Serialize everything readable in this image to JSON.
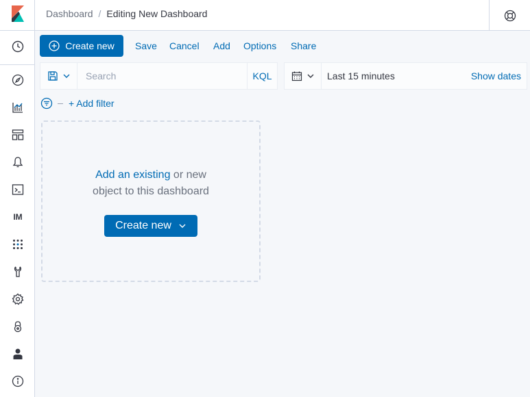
{
  "sidebar": {
    "items": [
      {
        "icon": "kibana-logo-icon"
      },
      {
        "icon": "recently-viewed-icon"
      },
      {
        "icon": "discover-icon"
      },
      {
        "icon": "visualize-icon"
      },
      {
        "icon": "dashboard-icon"
      },
      {
        "icon": "alerting-icon"
      },
      {
        "icon": "dev-tools-icon"
      },
      {
        "icon": "index-management-icon",
        "text": "IM"
      },
      {
        "icon": "apps-icon"
      },
      {
        "icon": "maintenance-icon"
      },
      {
        "icon": "settings-icon"
      },
      {
        "icon": "security-icon"
      },
      {
        "icon": "user-icon"
      },
      {
        "icon": "info-icon"
      }
    ]
  },
  "header": {
    "breadcrumb_root": "Dashboard",
    "breadcrumb_separator": "/",
    "breadcrumb_current": "Editing New Dashboard"
  },
  "toolbar": {
    "create_new": "Create new",
    "save": "Save",
    "cancel": "Cancel",
    "add": "Add",
    "options": "Options",
    "share": "Share"
  },
  "query": {
    "placeholder": "Search",
    "language": "KQL"
  },
  "time": {
    "label": "Last 15 minutes",
    "show_dates": "Show dates"
  },
  "filter": {
    "add_label": "+ Add filter"
  },
  "empty_panel": {
    "link_text": "Add an existing",
    "text_mid": " or new",
    "text_line2": "object to this dashboard",
    "button_label": "Create new"
  },
  "colors": {
    "accent": "#006bb4",
    "text": "#343741",
    "muted": "#69707d",
    "border": "#d3dae6",
    "background": "#f5f7fa"
  }
}
